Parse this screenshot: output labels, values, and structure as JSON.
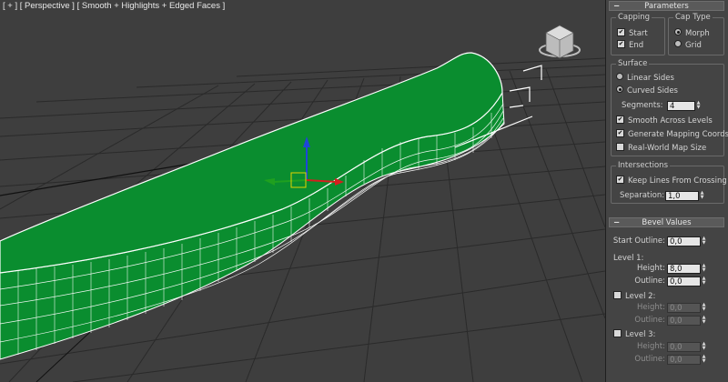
{
  "viewport": {
    "label": "[ + ] [ Perspective ] [ Smooth + Highlights + Edged Faces ]"
  },
  "colors": {
    "object_green": "#0a8d2f",
    "background": "#3e3e3e",
    "gizmo_x": "#d41f1f",
    "gizmo_y": "#1fa01f",
    "gizmo_z": "#1f46d8"
  },
  "icons": [
    "viewcube-icon",
    "transform-gizmo-icon",
    "checkbox-icon",
    "radio-icon",
    "spinner-arrows-icon",
    "collapse-minus-icon"
  ],
  "parameters": {
    "title": "Parameters",
    "capping": {
      "title": "Capping",
      "start": "Start",
      "end": "End",
      "start_checked": true,
      "end_checked": true
    },
    "cap_type": {
      "title": "Cap Type",
      "morph": "Morph",
      "grid": "Grid",
      "selected": "Morph"
    },
    "surface": {
      "title": "Surface",
      "linear_sides": "Linear Sides",
      "curved_sides": "Curved Sides",
      "selected": "Curved Sides",
      "segments_label": "Segments:",
      "segments_value": "4",
      "smooth_across_levels": "Smooth Across Levels",
      "generate_mapping": "Generate Mapping Coords.",
      "real_world": "Real-World Map Size"
    },
    "intersections": {
      "title": "Intersections",
      "keep_lines": "Keep Lines From Crossing",
      "separation_label": "Separation:",
      "separation_value": "1,0"
    }
  },
  "bevel": {
    "title": "Bevel Values",
    "start_outline_label": "Start Outline:",
    "start_outline_value": "0,0",
    "level1": {
      "label": "Level 1:",
      "height_label": "Height:",
      "height_value": "8,0",
      "outline_label": "Outline:",
      "outline_value": "0,0"
    },
    "level2": {
      "label": "Level 2:",
      "height_label": "Height:",
      "height_value": "0,0",
      "outline_label": "Outline:",
      "outline_value": "0,0"
    },
    "level3": {
      "label": "Level 3:",
      "height_label": "Height:",
      "height_value": "0,0",
      "outline_label": "Outline:",
      "outline_value": "0,0"
    }
  }
}
